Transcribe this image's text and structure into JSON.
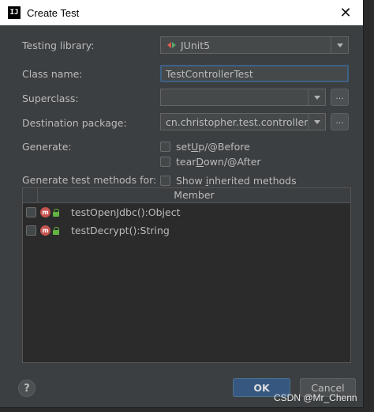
{
  "window": {
    "title": "Create Test"
  },
  "form": {
    "testing_library_label": "Testing library:",
    "testing_library_value": "JUnit5",
    "class_name_label": "Class name:",
    "class_name_value": "TestControllerTest",
    "superclass_label": "Superclass:",
    "superclass_value": "",
    "destination_label": "Destination package:",
    "destination_value": "cn.christopher.test.controller",
    "browse_label": "...",
    "generate_label": "Generate:",
    "setup_pre": "set",
    "setup_u": "U",
    "setup_post": "p/@Before",
    "teardown_pre": "tear",
    "teardown_u": "D",
    "teardown_post": "own/@After",
    "methods_label": "Generate test methods for:",
    "inherited_pre": "Show ",
    "inherited_u": "i",
    "inherited_post": "nherited methods"
  },
  "table": {
    "header_member": "Member",
    "rows": [
      {
        "badge": "m",
        "label": "testOpenJdbc():Object",
        "checked": false
      },
      {
        "badge": "m",
        "label": "testDecrypt():String",
        "checked": false
      }
    ]
  },
  "buttons": {
    "help": "?",
    "ok": "OK",
    "cancel": "Cancel"
  },
  "watermark": "CSDN @Mr_Chenn",
  "icons": {
    "app": "intellij-icon",
    "close": "close-icon",
    "library": "junit-icon",
    "dropdown": "chevron-down-icon",
    "method": "method-icon",
    "access": "public-lock-icon"
  },
  "colors": {
    "dialog_bg": "#3c3f41",
    "accent": "#365880",
    "focus_border": "#3d6185",
    "method_badge": "#c75450",
    "lock": "#62b543"
  }
}
